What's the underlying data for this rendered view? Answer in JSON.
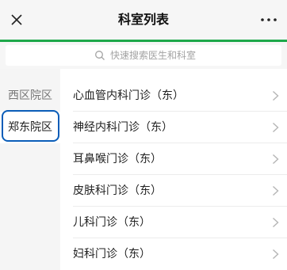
{
  "header": {
    "title": "科室列表",
    "close_icon": "close-icon",
    "more_icon": "more-icon"
  },
  "search": {
    "placeholder": "快速搜索医生和科室",
    "icon": "search-icon"
  },
  "sidebar": {
    "items": [
      {
        "label": "西区院区",
        "active": false
      },
      {
        "label": "郑东院区",
        "active": true
      }
    ]
  },
  "departments": [
    {
      "label": "心血管内科门诊（东）"
    },
    {
      "label": "神经内科门诊（东）"
    },
    {
      "label": "耳鼻喉门诊（东）"
    },
    {
      "label": "皮肤科门诊（东）"
    },
    {
      "label": "儿科门诊（东）"
    },
    {
      "label": "妇科门诊（东）"
    }
  ],
  "colors": {
    "accent": "#1ea84a",
    "focus": "#0a5db8"
  }
}
